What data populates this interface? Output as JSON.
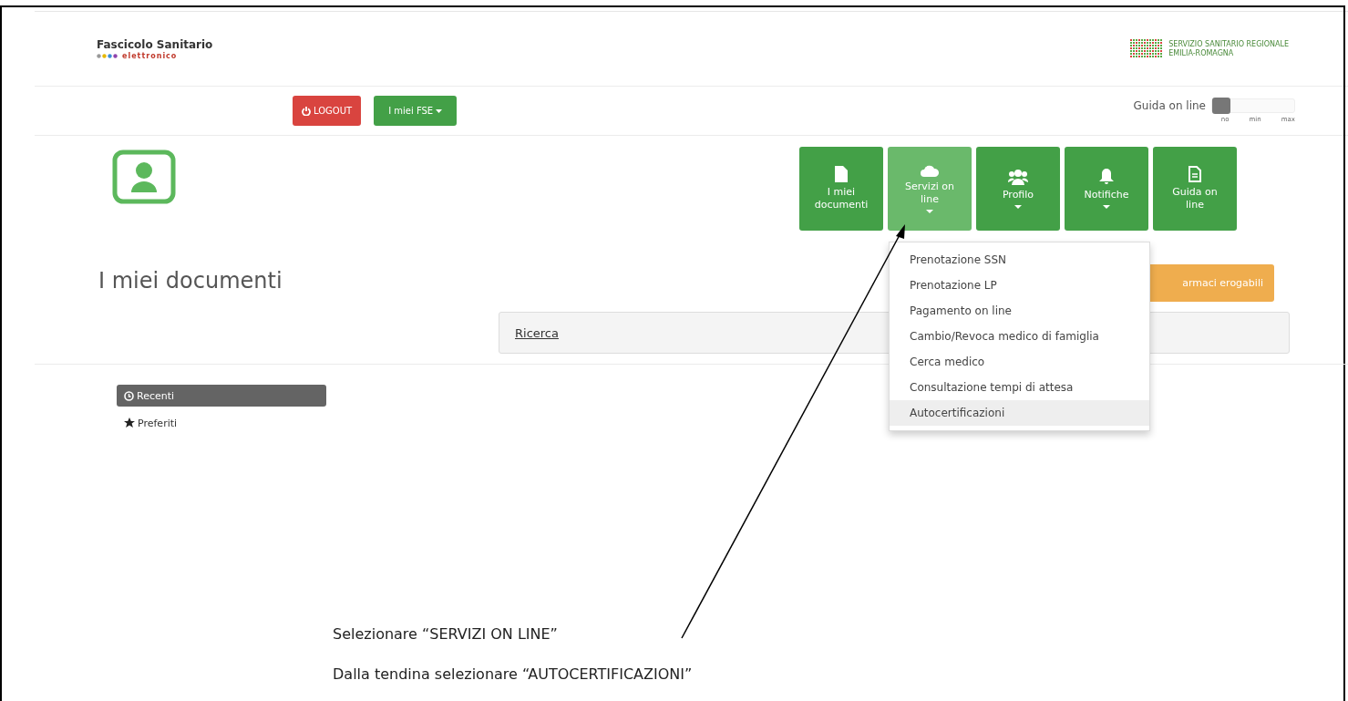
{
  "header": {
    "logo_title": "Fascicolo Sanitario",
    "logo_subtitle": "elettronico",
    "region_logo_lines": [
      "SERVIZIO SANITARIO REGIONALE",
      "EMILIA-ROMAGNA"
    ]
  },
  "toolbar": {
    "logout": "LOGOUT",
    "fse_menu": "I miei FSE",
    "guide": {
      "label": "Guida on line",
      "level": 0,
      "ticks": [
        "no",
        "min",
        "max"
      ]
    }
  },
  "nav": [
    {
      "kind": "document",
      "label": "I miei documenti",
      "selected": false,
      "caret": false
    },
    {
      "kind": "cloud",
      "label": "Servizi on line",
      "selected": true,
      "caret": true
    },
    {
      "kind": "users",
      "label": "Profilo",
      "selected": false,
      "caret": true
    },
    {
      "kind": "bell",
      "label": "Notifiche",
      "selected": false,
      "caret": true
    },
    {
      "kind": "guide",
      "label": "Guida on line",
      "selected": false,
      "caret": false
    }
  ],
  "dropdown": [
    {
      "label": "Prenotazione SSN",
      "selected": false
    },
    {
      "label": "Prenotazione LP",
      "selected": false
    },
    {
      "label": "Pagamento on line",
      "selected": false
    },
    {
      "label": "Cambio/Revoca medico di famiglia",
      "selected": false
    },
    {
      "label": "Cerca medico",
      "selected": false
    },
    {
      "label": "Consultazione tempi di attesa",
      "selected": false
    },
    {
      "label": "Autocertificazioni",
      "selected": true
    }
  ],
  "page_title": "I miei documenti",
  "drugs_button": "armaci erogabili",
  "search_link": "Ricerca",
  "sidebar": [
    {
      "kind": "clock",
      "label": "Recenti",
      "selected": true
    },
    {
      "kind": "star",
      "label": "Preferiti",
      "selected": false
    }
  ],
  "instructions": [
    "Selezionare “SERVIZI ON LINE”",
    "Dalla tendina selezionare “AUTOCERTIFICAZIONI”"
  ]
}
